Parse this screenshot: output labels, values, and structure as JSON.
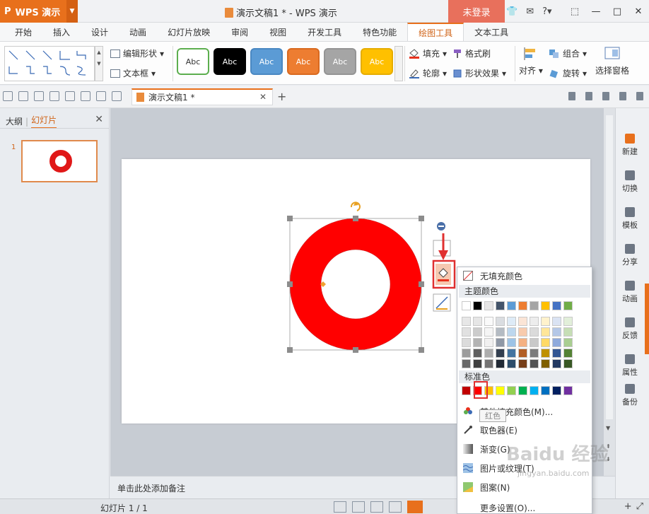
{
  "titlebar": {
    "app_name": "WPS 演示",
    "doc_title": "演示文稿1 * - WPS 演示",
    "login": "未登录"
  },
  "ribbon_tabs": [
    "开始",
    "插入",
    "设计",
    "动画",
    "幻灯片放映",
    "审阅",
    "视图",
    "开发工具",
    "特色功能",
    "绘图工具",
    "文本工具"
  ],
  "active_tab": "绘图工具",
  "ribbon": {
    "edit_shape": "编辑形状",
    "text_box": "文本框",
    "styles": [
      {
        "label": "Abc",
        "bg": "#ffffff",
        "fg": "#333333",
        "border": "#5cae4e"
      },
      {
        "label": "Abc",
        "bg": "#000000",
        "fg": "#ffffff",
        "border": "#000000"
      },
      {
        "label": "Abc",
        "bg": "#5b9bd5",
        "fg": "#ffffff",
        "border": "#4a88c2"
      },
      {
        "label": "Abc",
        "bg": "#ed7d31",
        "fg": "#ffffff",
        "border": "#d96a20"
      },
      {
        "label": "Abc",
        "bg": "#a5a5a5",
        "fg": "#ffffff",
        "border": "#949494"
      },
      {
        "label": "Abc",
        "bg": "#ffc000",
        "fg": "#ffffff",
        "border": "#e6ad00"
      }
    ],
    "fill": "填充",
    "format_painter": "格式刷",
    "outline": "轮廓",
    "shape_effects": "形状效果",
    "align": "对齐",
    "group": "组合",
    "rotate": "旋转",
    "selection_pane": "选择窗格"
  },
  "doc_tab": "演示文稿1 *",
  "left_panel": {
    "tab_outline": "大纲",
    "tab_slides": "幻灯片",
    "slide_number": "1"
  },
  "notes_placeholder": "单击此处添加备注",
  "right_sidebar": [
    "新建",
    "切换",
    "模板",
    "分享",
    "动画",
    "反馈",
    "属性",
    "备份"
  ],
  "status": {
    "slide_info": "幻灯片 1 / 1"
  },
  "dropdown": {
    "no_fill": "无填充颜色",
    "theme_colors": "主题颜色",
    "standard_colors": "标准色",
    "more_colors": "其他填充颜色(M)...",
    "eyedropper": "取色器(E)",
    "gradient": "渐变(G)",
    "picture_texture": "图片或纹理(T)",
    "pattern": "图案(N)",
    "more_settings": "更多设置(O)...",
    "tooltip": "红色",
    "theme_top": [
      "#ffffff",
      "#000000",
      "#e7e6e6",
      "#44546a",
      "#5b9bd5",
      "#ed7d31",
      "#a5a5a5",
      "#ffc000",
      "#4472c4",
      "#70ad47"
    ],
    "standard": [
      "#c00000",
      "#ff0000",
      "#ffc000",
      "#ffff00",
      "#92d050",
      "#00b050",
      "#00b0f0",
      "#0070c0",
      "#002060",
      "#7030a0"
    ]
  },
  "colors": {
    "accent": "#e8701c",
    "shape_fill": "#ff0000",
    "highlight": "#e03030"
  },
  "watermark": {
    "text": "Baidu 经验",
    "url": "jingyan.baidu.com"
  }
}
